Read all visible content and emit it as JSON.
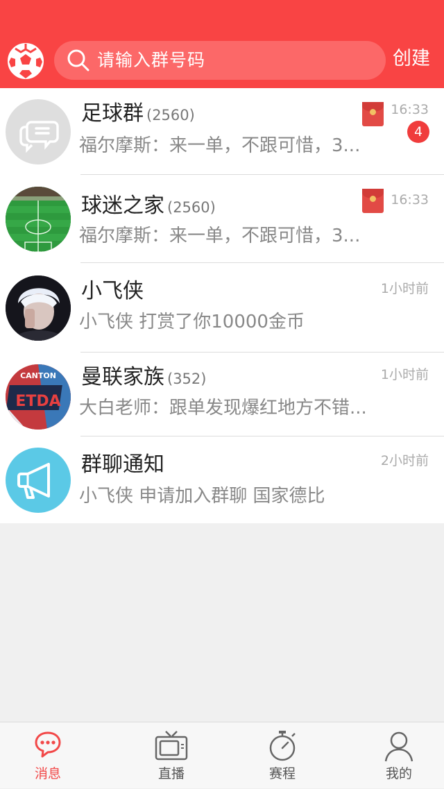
{
  "header": {
    "search_placeholder": "请输入群号码",
    "create_label": "创建",
    "logo_icon": "soccer-ball-icon",
    "search_icon": "search-icon"
  },
  "conversations": [
    {
      "name": "足球群",
      "count": "(2560)",
      "message": "福尔摩斯：来一单，不跟可惜，3...",
      "time": "16:33",
      "red_packet": true,
      "unread": "4",
      "avatar": "group-chat-icon"
    },
    {
      "name": "球迷之家",
      "count": "(2560)",
      "message": "福尔摩斯：来一单，不跟可惜，3...",
      "time": "16:33",
      "red_packet": true,
      "avatar": "stadium-photo"
    },
    {
      "name": "小飞侠",
      "count": "",
      "message": "小飞侠 打赏了你10000金币",
      "time": "1小时前",
      "avatar": "user-photo"
    },
    {
      "name": "曼联家族",
      "count": "(352)",
      "message": "大白老师：跟单发现爆红地方不错...",
      "time": "1小时前",
      "avatar": "team-logo",
      "avatar_text": "CANTON"
    },
    {
      "name": "群聊通知",
      "count": "",
      "message": "小飞侠 申请加入群聊 国家德比",
      "time": "2小时前",
      "avatar": "megaphone-icon"
    }
  ],
  "tabs": [
    {
      "label": "消息",
      "icon": "message-icon",
      "active": true
    },
    {
      "label": "直播",
      "icon": "tv-icon",
      "active": false
    },
    {
      "label": "赛程",
      "icon": "stopwatch-icon",
      "active": false
    },
    {
      "label": "我的",
      "icon": "user-icon",
      "active": false
    }
  ],
  "colors": {
    "brand": "#f94444",
    "search_bg": "#fc6868",
    "active_tab": "#f24848",
    "badge": "#f03c3c",
    "notice_avatar": "#5bc9e6"
  }
}
